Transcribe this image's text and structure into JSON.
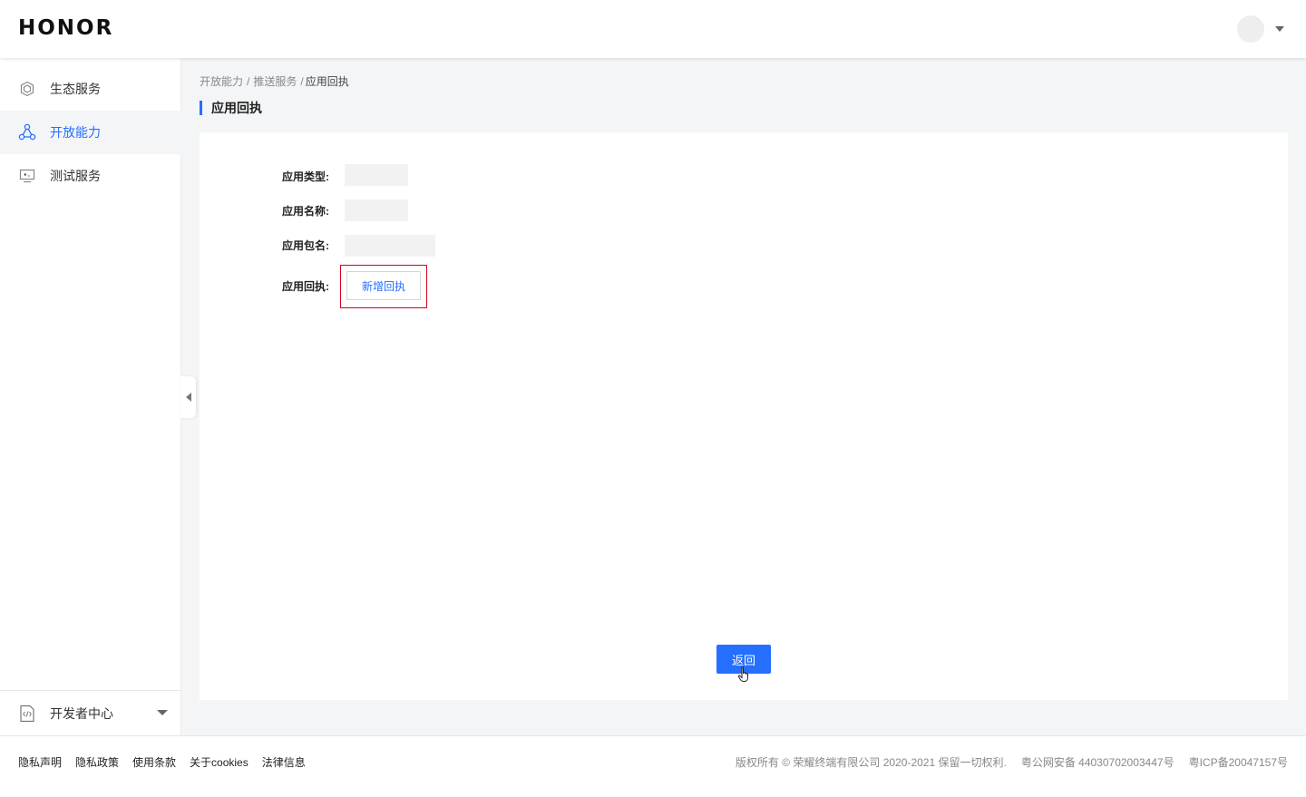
{
  "header": {
    "logo": "HONOR"
  },
  "sidebar": {
    "items": [
      {
        "label": "生态服务",
        "icon": "cube-icon",
        "active": false
      },
      {
        "label": "开放能力",
        "icon": "share-nodes-icon",
        "active": true
      },
      {
        "label": "测试服务",
        "icon": "monitor-icon",
        "active": false
      }
    ],
    "bottom": {
      "label": "开发者中心",
      "icon": "code-file-icon"
    }
  },
  "breadcrumb": {
    "items": [
      "开放能力",
      "推送服务",
      "应用回执"
    ],
    "separator": "/"
  },
  "page": {
    "title": "应用回执"
  },
  "form": {
    "app_type_label": "应用类型:",
    "app_name_label": "应用名称:",
    "package_label": "应用包名:",
    "receipt_label": "应用回执:",
    "add_receipt_button": "新增回执",
    "back_button": "返回"
  },
  "footer": {
    "links": [
      "隐私声明",
      "隐私政策",
      "使用条款",
      "关于cookies",
      "法律信息"
    ],
    "copyright": "版权所有 © 荣耀终端有限公司 2020-2021 保留一切权利.",
    "police_record": "粤公网安备 44030702003447号",
    "icp": "粤ICP备20047157号"
  },
  "colors": {
    "accent": "#256fff",
    "highlight": "#d0021b",
    "background": "#f4f5f7"
  }
}
